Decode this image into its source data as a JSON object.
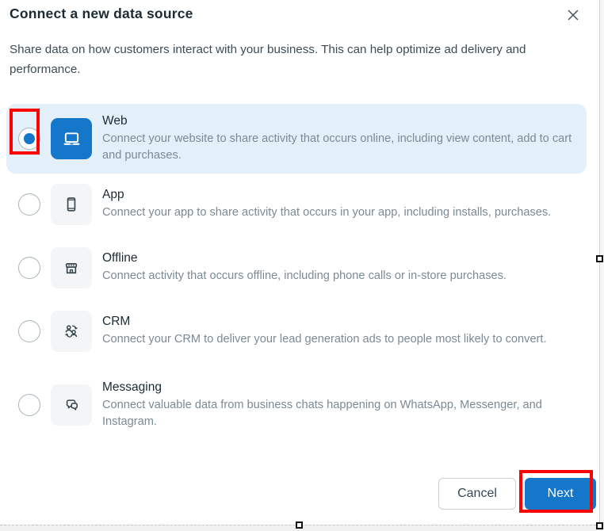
{
  "dialog": {
    "title": "Connect a new data source",
    "description": "Share data on how customers interact with your business. This can help optimize ad delivery and performance.",
    "options": [
      {
        "label": "Web",
        "description": "Connect your website to share activity that occurs online, including view content, add to cart and purchases.",
        "selected": true,
        "icon": "laptop-icon"
      },
      {
        "label": "App",
        "description": "Connect your app to share activity that occurs in your app, including installs, purchases.",
        "selected": false,
        "icon": "mobile-phone-icon"
      },
      {
        "label": "Offline",
        "description": "Connect activity that occurs offline, including phone calls or in-store purchases.",
        "selected": false,
        "icon": "storefront-icon"
      },
      {
        "label": "CRM",
        "description": "Connect your CRM to deliver your lead generation ads to people most likely to convert.",
        "selected": false,
        "icon": "people-sync-icon"
      },
      {
        "label": "Messaging",
        "description": "Connect valuable data from business chats happening on WhatsApp, Messenger, and Instagram.",
        "selected": false,
        "icon": "chat-bubbles-icon"
      }
    ],
    "footer": {
      "cancel_label": "Cancel",
      "next_label": "Next"
    },
    "colors": {
      "accent_blue": "#1577c9",
      "selected_row_bg": "#e4f0f9",
      "annotation_red": "#fd0202"
    }
  }
}
